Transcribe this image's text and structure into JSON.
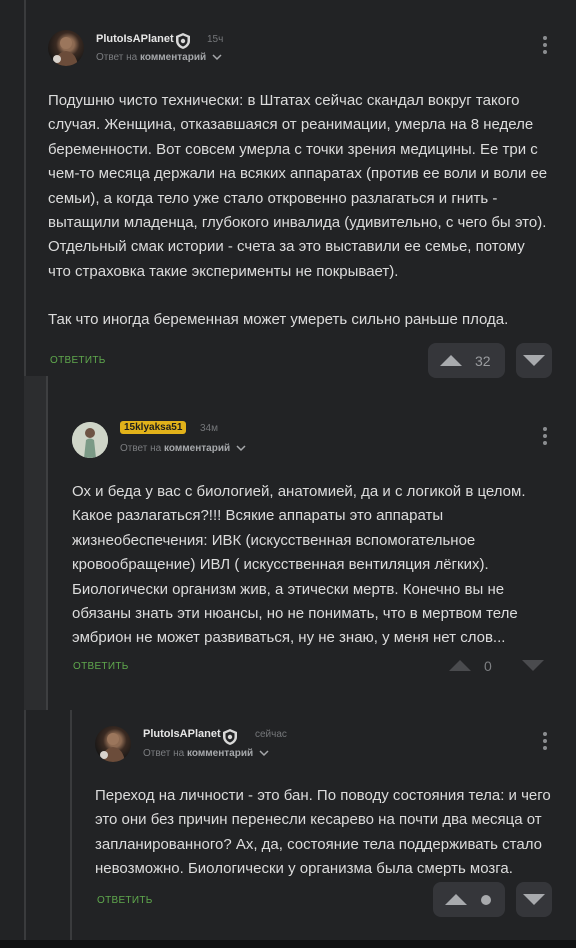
{
  "comments": [
    {
      "username": "PlutoIsAPlanet",
      "time": "15ч",
      "reply_to_prefix": "Ответ на",
      "reply_to_target": "комментарий",
      "paragraphs": [
        "Подушню чисто технически: в Штатах сейчас скандал вокруг такого случая. Женщина, отказавшаяся от реанимации, умерла на 8 неделе беременности. Вот совсем умерла с точки зрения медицины. Ее три с чем-то месяца держали на всяких аппаратах (против ее воли и воли ее семьи), а когда тело уже стало откровенно разлагаться и гнить - вытащили младенца, глубокого инвалида (удивительно, с чего бы это). Отдельный смак истории - счета за это выставили ее семье, потому что страховка такие эксперименты не покрывает).",
        "Так что иногда беременная может умереть сильно раньше плода."
      ],
      "reply_label": "ОТВЕТИТЬ",
      "votes": "32"
    },
    {
      "username": "15klyaksa51",
      "time": "34м",
      "reply_to_prefix": "Ответ на",
      "reply_to_target": "комментарий",
      "paragraphs": [
        "Ох и беда у вас с биологией, анатомией, да и с логикой в целом. Какое разлагаться?!!! Всякие аппараты это аппараты жизнеобеспечения: ИВК (искусственная вспомогательное кровообращение) ИВЛ ( искусственная вентиляция лёгких). Биологически организм жив, а этически мертв. Конечно вы не обязаны знать эти нюансы, но не понимать, что в мертвом теле эмбрион не может развиваться, ну не знаю, у меня нет слов..."
      ],
      "reply_label": "ОТВЕТИТЬ",
      "votes": "0"
    },
    {
      "username": "PlutoIsAPlanet",
      "time": "сейчас",
      "reply_to_prefix": "Ответ на",
      "reply_to_target": "комментарий",
      "paragraphs": [
        "Переход на личности - это бан. По поводу состояния тела: и чего это они без причин перенесли кесарево на почти два месяца от запланированного? Ах, да, состояние тела поддерживать стало невозможно. Биологически у организма была смерть мозга."
      ],
      "reply_label": "ОТВЕТИТЬ",
      "votes": ""
    }
  ],
  "colors": {
    "background": "#222325",
    "accent_reply": "#5fa84d",
    "username_badge": "#e2b21a"
  },
  "icons": {
    "verified": "shield-check-icon",
    "more": "kebab-menu-icon",
    "upvote": "arrow-up-icon",
    "downvote": "arrow-down-icon",
    "expand": "chevron-down-icon"
  }
}
